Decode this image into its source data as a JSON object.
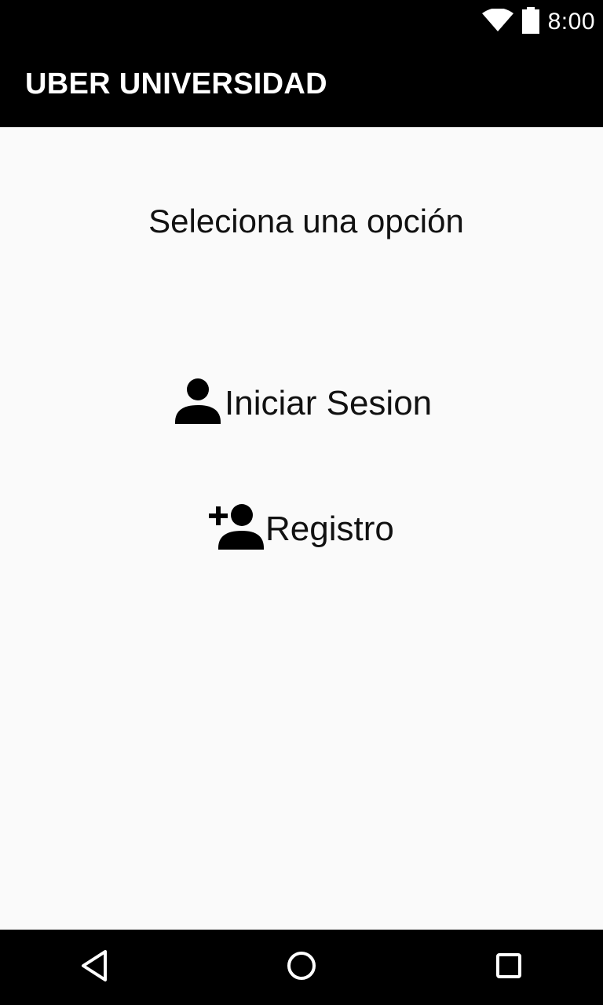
{
  "status_bar": {
    "time": "8:00",
    "icons": [
      "wifi-icon",
      "battery-icon"
    ]
  },
  "app_bar": {
    "title": "UBER UNIVERSIDAD"
  },
  "main": {
    "prompt": "Seleciona una opción",
    "options": [
      {
        "label": "Iniciar Sesion",
        "icon": "person-icon"
      },
      {
        "label": "Registro",
        "icon": "person-add-icon"
      }
    ]
  },
  "nav_bar": {
    "buttons": [
      "back-icon",
      "home-icon",
      "recents-icon"
    ]
  },
  "colors": {
    "bars": "#000000",
    "background": "#fafafa",
    "text": "#111111"
  }
}
